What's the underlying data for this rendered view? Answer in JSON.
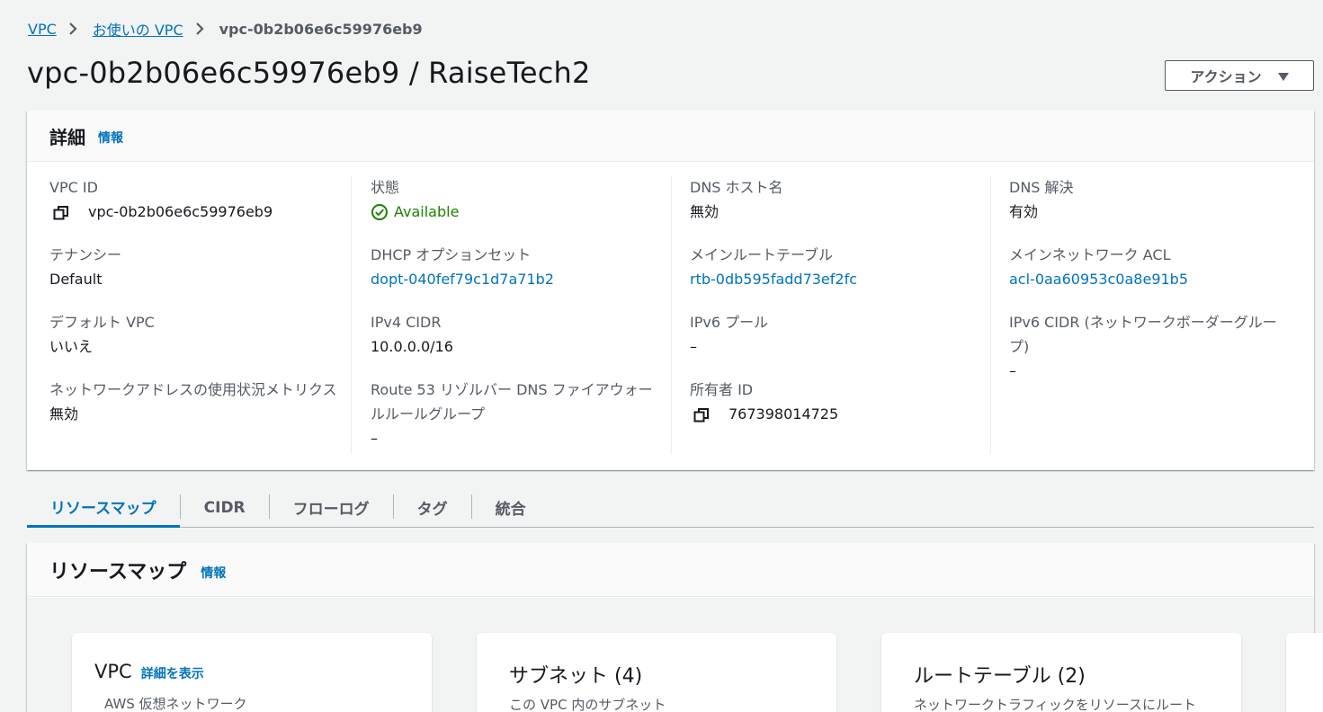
{
  "breadcrumb": {
    "items": [
      "VPC",
      "お使いの VPC"
    ],
    "current": "vpc-0b2b06e6c59976eb9"
  },
  "page": {
    "title": "vpc-0b2b06e6c59976eb9 / RaiseTech2",
    "action_label": "アクション"
  },
  "details": {
    "title": "詳細",
    "info": "情報",
    "vpc_id": {
      "label": "VPC ID",
      "value": "vpc-0b2b06e6c59976eb9"
    },
    "tenancy": {
      "label": "テナンシー",
      "value": "Default"
    },
    "default_vpc": {
      "label": "デフォルト VPC",
      "value": "いいえ"
    },
    "net_metrics": {
      "label": "ネットワークアドレスの使用状況メトリクス",
      "value": "無効"
    },
    "state": {
      "label": "状態",
      "value": "Available"
    },
    "dhcp": {
      "label": "DHCP オプションセット",
      "value": "dopt-040fef79c1d7a71b2"
    },
    "ipv4_cidr": {
      "label": "IPv4 CIDR",
      "value": "10.0.0.0/16"
    },
    "route53": {
      "label": "Route 53 リゾルバー DNS ファイアウォールルールグループ",
      "value": "–"
    },
    "dns_hostnames": {
      "label": "DNS ホスト名",
      "value": "無効"
    },
    "main_route_table": {
      "label": "メインルートテーブル",
      "value": "rtb-0db595fadd73ef2fc"
    },
    "ipv6_pool": {
      "label": "IPv6 プール",
      "value": "–"
    },
    "owner_id": {
      "label": "所有者 ID",
      "value": "767398014725"
    },
    "dns_resolution": {
      "label": "DNS 解決",
      "value": "有効"
    },
    "main_acl": {
      "label": "メインネットワーク ACL",
      "value": "acl-0aa60953c0a8e91b5"
    },
    "ipv6_cidr": {
      "label": "IPv6 CIDR (ネットワークボーダーグループ)",
      "value": "–"
    }
  },
  "tabs": [
    {
      "label": "リソースマップ",
      "active": true
    },
    {
      "label": "CIDR"
    },
    {
      "label": "フローログ"
    },
    {
      "label": "タグ"
    },
    {
      "label": "統合"
    }
  ],
  "resource_map": {
    "title": "リソースマップ",
    "info": "情報",
    "cards": [
      {
        "title": "VPC",
        "link": "詳細を表示",
        "subtitle": "AWS 仮想ネットワーク"
      },
      {
        "title": "サブネット (4)",
        "subtitle": "この VPC 内のサブネット"
      },
      {
        "title": "ルートテーブル (2)",
        "subtitle": "ネットワークトラフィックをリソースにルート"
      }
    ]
  },
  "colors": {
    "link": "#0073bb",
    "success": "#1d8102",
    "label": "#545b64",
    "background": "#f2f3f3"
  },
  "icons": [
    "chevron-right-icon",
    "copy-icon",
    "status-success-icon",
    "caret-down-icon"
  ]
}
